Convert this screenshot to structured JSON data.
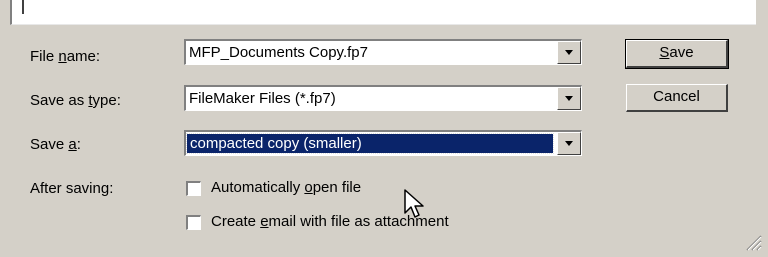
{
  "form": {
    "file_name_label_pre": "File ",
    "file_name_label_u": "n",
    "file_name_label_post": "ame:",
    "file_name_value": "MFP_Documents Copy.fp7",
    "save_as_type_label_pre": "Save as ",
    "save_as_type_label_u": "t",
    "save_as_type_label_post": "ype:",
    "save_as_type_value": "FileMaker Files (*.fp7)",
    "save_a_label_pre": "Save ",
    "save_a_label_u": "a",
    "save_a_label_post": ":",
    "save_a_value": "compacted copy (smaller)",
    "after_saving_label": "After saving:",
    "open_file_pre": "Automatically ",
    "open_file_u": "o",
    "open_file_post": "pen file",
    "open_file_checked": false,
    "email_pre": "Create ",
    "email_u": "e",
    "email_post": "mail with file as attachment",
    "email_checked": false
  },
  "buttons": {
    "save_u": "S",
    "save_post": "ave",
    "cancel": "Cancel"
  },
  "icons": [
    "dropdown-arrow-icon",
    "mouse-pointer-icon",
    "resize-grip-icon"
  ]
}
